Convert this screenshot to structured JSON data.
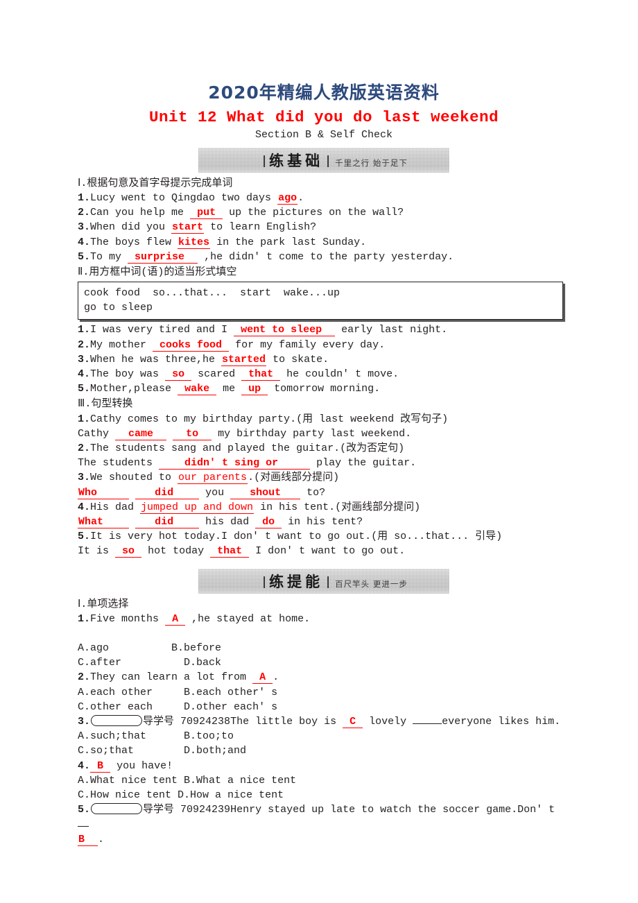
{
  "doc": {
    "banner_title": "2020年精编人教版英语资料",
    "unit_title": "Unit 12 What did you do last weekend",
    "section_subtitle": "Section B & Self Check"
  },
  "banners": {
    "basics": {
      "main": "练基础",
      "motto": "千里之行 始于足下"
    },
    "ability": {
      "main": "练提能",
      "motto": "百尺竿头 更进一步"
    }
  },
  "part1": {
    "heading": "Ⅰ.根据句意及首字母提示完成单词",
    "items": [
      {
        "num": "1.",
        "pre": "Lucy went to Qingdao two days ",
        "ans": "ago",
        "post": "."
      },
      {
        "num": "2.",
        "pre": "Can you help me ",
        "ans": "put",
        "post": " up the pictures on the wall?"
      },
      {
        "num": "3.",
        "pre": "When did you ",
        "ans": "start",
        "post": " to learn English?"
      },
      {
        "num": "4.",
        "pre": "The boys flew ",
        "ans": "kites",
        "post": " in the park last Sunday."
      },
      {
        "num": "5.",
        "pre": "To my ",
        "ans": "surprise",
        "post": " ,he didn' t come to the party yesterday."
      }
    ]
  },
  "part2": {
    "heading": "Ⅱ.用方框中词(语)的适当形式填空",
    "wordbank": [
      "cook food  so...that...  start  wake...up",
      "go to sleep"
    ],
    "items": [
      {
        "num": "1.",
        "pre": "I was very tired and I ",
        "ans": "went to sleep",
        "post": " early last night."
      },
      {
        "num": "2.",
        "pre": "My mother ",
        "ans": "cooks food",
        "post": " for my family every day."
      },
      {
        "num": "3.",
        "pre": "When he was three,he ",
        "ans": "started",
        "post": " to skate."
      },
      {
        "num": "4.",
        "pre": "The boy was ",
        "ans": "so",
        "mid": " scared ",
        "ans2": "that",
        "post": " he couldn' t move."
      },
      {
        "num": "5.",
        "pre": "Mother,please ",
        "ans": "wake",
        "mid": " me ",
        "ans2": "up",
        "post": " tomorrow morning."
      }
    ]
  },
  "part3": {
    "heading": "Ⅲ.句型转换",
    "q1": {
      "num": "1.",
      "prompt": "Cathy comes to my birthday party.(用 last weekend 改写句子)",
      "a_pre": "Cathy ",
      "a_ans1": "came",
      "a_mid": " ",
      "a_ans2": "to",
      "a_post": " my birthday party last weekend."
    },
    "q2": {
      "num": "2.",
      "prompt": "The students sang and played the guitar.(改为否定句)",
      "a_pre": "The students ",
      "a_ans1": "didn' t sing or",
      "a_post": " play the guitar."
    },
    "q3": {
      "num": "3.",
      "prompt_pre": "We shouted to ",
      "prompt_ul": "our parents",
      "prompt_post": ".(对画线部分提问)",
      "a_ans1": "Who",
      "a_ans2": "did",
      "a_mid": " you ",
      "a_ans3": "shout",
      "a_post": " to?"
    },
    "q4": {
      "num": "4.",
      "prompt_pre": "His dad ",
      "prompt_ul": "jumped up and down",
      "prompt_post": " in his tent.(对画线部分提问)",
      "a_ans1": "What",
      "a_ans2": "did",
      "a_mid": " his dad ",
      "a_ans3": "do",
      "a_post": " in his tent?"
    },
    "q5": {
      "num": "5.",
      "prompt": "It is very hot today.I don' t want to go out.(用 so...that... 引导)",
      "a_pre": "It is ",
      "a_ans1": "so",
      "a_mid": " hot today ",
      "a_ans2": "that",
      "a_post": " I don' t want to go out."
    }
  },
  "part4": {
    "heading": "Ⅰ.单项选择",
    "q1": {
      "num": "1.",
      "pre": "Five months ",
      "ans": "A",
      "post": " ,he stayed at home.",
      "options": [
        "A.ago",
        "B.before",
        "C.after",
        "D.back"
      ]
    },
    "q2": {
      "num": "2.",
      "pre": "They can learn a lot from ",
      "ans": "A",
      "post": ".",
      "options": [
        "A.each other",
        "B.each other' s",
        "C.other each",
        "D.other each' s"
      ]
    },
    "q3": {
      "num": "3.",
      "tag_label": "导学号",
      "tag_code": "70924238",
      "pre": "The little boy is ",
      "ans": "C",
      "mid": " lovely ",
      "post": "everyone likes him.",
      "options": [
        "A.such;that",
        "B.too;to",
        "C.so;that",
        "D.both;and"
      ]
    },
    "q4": {
      "num": "4.",
      "ans": "B",
      "post": " you have!",
      "options": [
        "A.What nice tent",
        "B.What a nice tent",
        "C.How nice tent",
        "D.How a nice tent"
      ]
    },
    "q5": {
      "num": "5.",
      "tag_label": "导学号",
      "tag_code": "70924239",
      "pre": "Henry stayed up late to watch the soccer game.Don' t ",
      "ans": "B",
      "post": "."
    }
  }
}
